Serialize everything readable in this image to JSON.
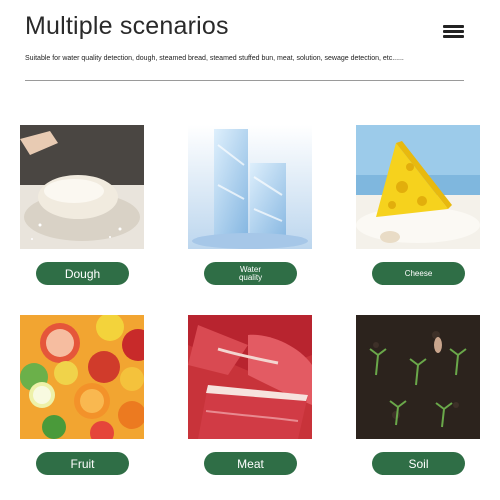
{
  "header": {
    "title": "Multiple scenarios",
    "subtitle": "Suitable for water quality detection, dough, steamed bread, steamed stuffed bun, meat, solution, sewage detection, etc......"
  },
  "scenarios": [
    {
      "label": "Dough",
      "icon": "dough-photo"
    },
    {
      "label": "Water quality",
      "icon": "water-ice-photo"
    },
    {
      "label": "Cheese",
      "icon": "cheese-photo"
    },
    {
      "label": "Fruit",
      "icon": "fruit-photo"
    },
    {
      "label": "Meat",
      "icon": "meat-photo"
    },
    {
      "label": "Soil",
      "icon": "soil-photo"
    }
  ],
  "colors": {
    "pill_bg": "#2f6e46",
    "pill_text": "#ffffff"
  }
}
